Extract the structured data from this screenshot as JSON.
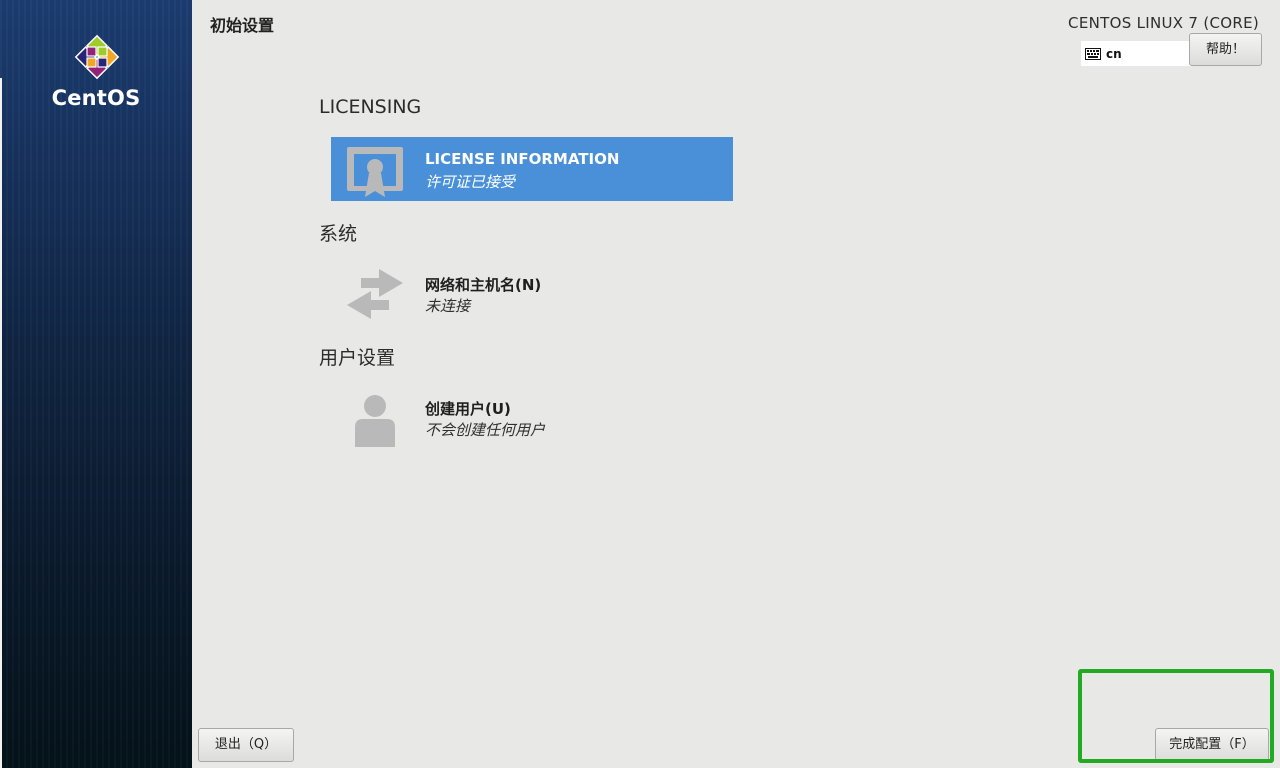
{
  "sidebar": {
    "brand": "CentOS",
    "logo_icon": "centos-logo-icon"
  },
  "header": {
    "title": "初始设置",
    "product": "CENTOS LINUX 7 (CORE)",
    "keyboard_layout": "cn",
    "keyboard_icon": "keyboard-icon",
    "help_label": "帮助！"
  },
  "sections": {
    "licensing": {
      "title": "LICENSING",
      "spoke": {
        "title": "LICENSE INFORMATION",
        "status": "许可证已接受",
        "icon": "certificate-icon"
      }
    },
    "system": {
      "title": "系统",
      "spoke": {
        "title": "网络和主机名(N)",
        "status": "未连接",
        "icon": "network-arrows-icon"
      }
    },
    "user": {
      "title": "用户设置",
      "spoke": {
        "title": "创建用户(U)",
        "status": "不会创建任何用户",
        "icon": "user-icon"
      }
    }
  },
  "footer": {
    "quit_label": "退出（Q）",
    "finish_label": "完成配置（F）"
  },
  "colors": {
    "selected_spoke": "#4a90d9",
    "highlight": "#22aa22",
    "sidebar_top": "#1c3d72",
    "sidebar_bottom": "#04121a"
  }
}
